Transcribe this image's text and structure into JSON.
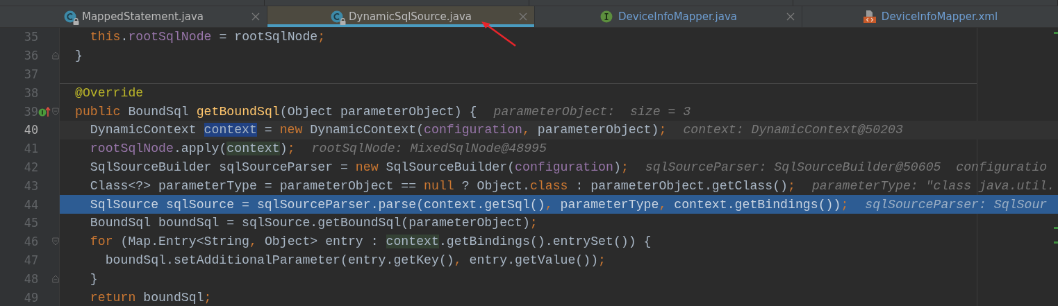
{
  "tabs": [
    {
      "label": "MappedStatement.java",
      "kind": "class",
      "locked": true,
      "selected": false,
      "modified": false,
      "closable": true
    },
    {
      "label": "DynamicSqlSource.java",
      "kind": "class",
      "locked": true,
      "selected": true,
      "modified": false,
      "closable": true
    },
    {
      "label": "DeviceInfoMapper.java",
      "kind": "interface",
      "locked": false,
      "selected": false,
      "modified": true,
      "closable": true
    },
    {
      "label": "DeviceInfoMapper.xml",
      "kind": "xml",
      "locked": false,
      "selected": false,
      "modified": true,
      "closable": false
    }
  ],
  "lines": [
    {
      "number": "35",
      "current": false,
      "execution_point": false,
      "separator": false,
      "code": [
        {
          "kind": "keyword",
          "text": "  this"
        },
        {
          "kind": "plain",
          "text": "."
        },
        {
          "kind": "field",
          "text": "rootSqlNode"
        },
        {
          "kind": "plain",
          "text": " = rootSqlNode"
        },
        {
          "kind": "punct",
          "text": ";"
        }
      ]
    },
    {
      "number": "36",
      "current": false,
      "execution_point": false,
      "separator": false,
      "fold_end": true,
      "code": [
        {
          "kind": "plain",
          "text": "}"
        }
      ]
    },
    {
      "number": "37",
      "current": false,
      "execution_point": false,
      "separator": false
    },
    {
      "number": "38",
      "current": false,
      "execution_point": false,
      "separator": true,
      "code": [
        {
          "kind": "annotation",
          "text": "@Override"
        }
      ]
    },
    {
      "number": "39",
      "current": false,
      "execution_point": false,
      "separator": false,
      "fold_start": true,
      "implements_marker": true,
      "code": [
        {
          "kind": "keyword",
          "text": "public"
        },
        {
          "kind": "plain",
          "text": " BoundSql "
        },
        {
          "kind": "method",
          "text": "getBoundSql"
        },
        {
          "kind": "plain",
          "text": "(Object parameterObject) {"
        }
      ],
      "hint": "parameterObject:  size = 3"
    },
    {
      "number": "40",
      "current": true,
      "execution_point": false,
      "separator": false,
      "code": [
        {
          "kind": "plain",
          "text": "  DynamicContext "
        },
        {
          "kind": "write_usage",
          "text": "context"
        },
        {
          "kind": "plain",
          "text": " = "
        },
        {
          "kind": "keyword",
          "text": "new"
        },
        {
          "kind": "plain",
          "text": " DynamicContext("
        },
        {
          "kind": "field",
          "text": "configuration"
        },
        {
          "kind": "punct",
          "text": ","
        },
        {
          "kind": "plain",
          "text": " parameterObject)"
        },
        {
          "kind": "punct",
          "text": ";"
        }
      ],
      "hint": "context: DynamicContext@50203"
    },
    {
      "number": "41",
      "current": false,
      "execution_point": false,
      "separator": false,
      "code": [
        {
          "kind": "field",
          "text": "  rootSqlNode"
        },
        {
          "kind": "plain",
          "text": ".apply("
        },
        {
          "kind": "read_usage",
          "text": "context"
        },
        {
          "kind": "plain",
          "text": ")"
        },
        {
          "kind": "punct",
          "text": ";"
        }
      ],
      "hint": "rootSqlNode: MixedSqlNode@48995"
    },
    {
      "number": "42",
      "current": false,
      "execution_point": false,
      "separator": false,
      "code": [
        {
          "kind": "plain",
          "text": "  SqlSourceBuilder sqlSourceParser = "
        },
        {
          "kind": "keyword",
          "text": "new"
        },
        {
          "kind": "plain",
          "text": " SqlSourceBuilder("
        },
        {
          "kind": "field",
          "text": "configuration"
        },
        {
          "kind": "plain",
          "text": ")"
        },
        {
          "kind": "punct",
          "text": ";"
        }
      ],
      "hint": "sqlSourceParser: SqlSourceBuilder@50605  configuratio"
    },
    {
      "number": "43",
      "current": false,
      "execution_point": false,
      "separator": false,
      "code": [
        {
          "kind": "plain",
          "text": "  Class<?> parameterType = parameterObject == "
        },
        {
          "kind": "keyword",
          "text": "null"
        },
        {
          "kind": "plain",
          "text": " ? Object."
        },
        {
          "kind": "keyword",
          "text": "class"
        },
        {
          "kind": "plain",
          "text": " : parameterObject.getClass()"
        },
        {
          "kind": "punct",
          "text": ";"
        }
      ],
      "hint": "parameterType: \"class java.util."
    },
    {
      "number": "44",
      "current": false,
      "execution_point": true,
      "separator": false,
      "code": [
        {
          "kind": "plain",
          "text": "  SqlSource sqlSource = sqlSourceParser.parse(context.getSql()"
        },
        {
          "kind": "punct",
          "text": ","
        },
        {
          "kind": "plain",
          "text": " parameterType"
        },
        {
          "kind": "punct",
          "text": ","
        },
        {
          "kind": "plain",
          "text": " context.getBindings())"
        },
        {
          "kind": "punct",
          "text": ";"
        }
      ],
      "hint": "sqlSourceParser: SqlSour"
    },
    {
      "number": "45",
      "current": false,
      "execution_point": false,
      "separator": false,
      "code": [
        {
          "kind": "plain",
          "text": "  BoundSql boundSql = sqlSource.getBoundSql(parameterObject)"
        },
        {
          "kind": "punct",
          "text": ";"
        }
      ]
    },
    {
      "number": "46",
      "current": false,
      "execution_point": false,
      "separator": false,
      "fold_start": true,
      "code": [
        {
          "kind": "keyword",
          "text": "  for"
        },
        {
          "kind": "plain",
          "text": " (Map.Entry<String"
        },
        {
          "kind": "punct",
          "text": ","
        },
        {
          "kind": "plain",
          "text": " Object> entry : "
        },
        {
          "kind": "read_usage",
          "text": "context"
        },
        {
          "kind": "plain",
          "text": ".getBindings().entrySet()) {"
        }
      ]
    },
    {
      "number": "47",
      "current": false,
      "execution_point": false,
      "separator": false,
      "code": [
        {
          "kind": "plain",
          "text": "    boundSql.setAdditionalParameter(entry.getKey()"
        },
        {
          "kind": "punct",
          "text": ","
        },
        {
          "kind": "plain",
          "text": " entry.getValue())"
        },
        {
          "kind": "punct",
          "text": ";"
        }
      ]
    },
    {
      "number": "48",
      "current": false,
      "execution_point": false,
      "separator": false,
      "fold_end": true,
      "code": [
        {
          "kind": "plain",
          "text": "  }"
        }
      ]
    },
    {
      "number": "49",
      "current": false,
      "execution_point": false,
      "separator": false,
      "code": [
        {
          "kind": "keyword",
          "text": "  return"
        },
        {
          "kind": "plain",
          "text": " boundSql"
        },
        {
          "kind": "punct",
          "text": ";"
        }
      ]
    }
  ]
}
